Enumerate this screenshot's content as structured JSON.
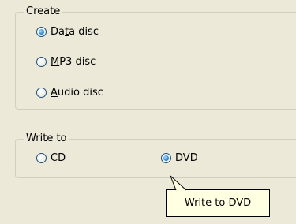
{
  "create_group": {
    "legend": "Create",
    "options": [
      {
        "pre": "Da",
        "ul": "t",
        "post": "a disc",
        "checked": true
      },
      {
        "pre": "",
        "ul": "M",
        "post": "P3 disc",
        "checked": false
      },
      {
        "pre": "",
        "ul": "A",
        "post": "udio disc",
        "checked": false
      }
    ]
  },
  "write_group": {
    "legend": "Write to",
    "options": [
      {
        "pre": "",
        "ul": "C",
        "post": "D",
        "checked": false
      },
      {
        "pre": "",
        "ul": "D",
        "post": "VD",
        "checked": true
      }
    ]
  },
  "tooltip": {
    "text": "Write to DVD"
  },
  "colors": {
    "radio_fill": "#2f8fe0",
    "tooltip_bg": "#ffffe1",
    "dialog_bg": "#ece9d8"
  }
}
